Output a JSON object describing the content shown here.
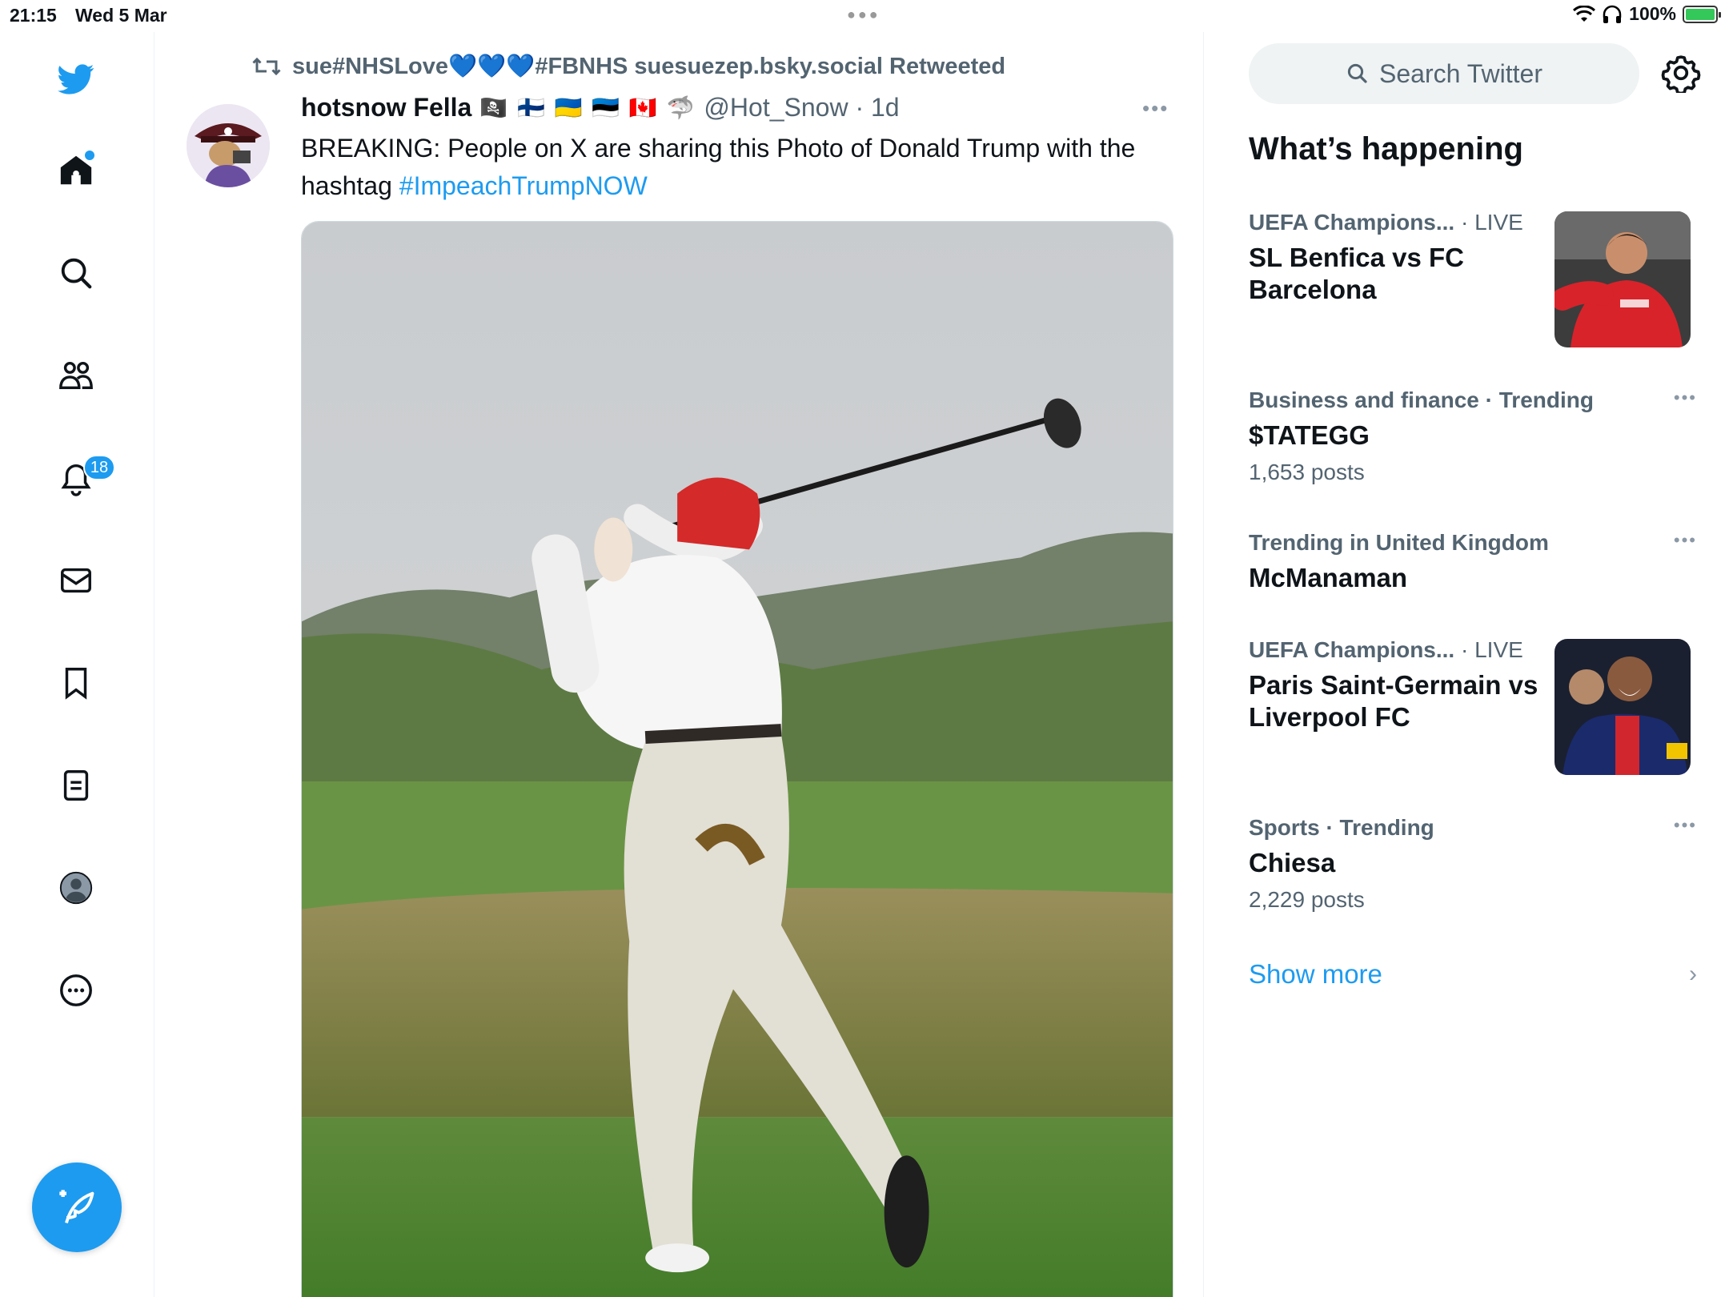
{
  "status_bar": {
    "time": "21:15",
    "date": "Wed 5 Mar",
    "battery": "100%"
  },
  "nav": {
    "notifications_badge": "18"
  },
  "tweet": {
    "retweeted_by": "sue#NHSLove💙💙💙#FBNHS suesuezep.bsky.social Retweeted",
    "author_name": "hotsnow Fella",
    "author_flags": "🏴‍☠️ 🇫🇮 🇺🇦 🇪🇪 🇨🇦 🦈",
    "handle_time": "@Hot_Snow · 1d",
    "text_prefix": "BREAKING: People on X are sharing this Photo of Donald Trump with the hashtag ",
    "hashtag": "#ImpeachTrumpNOW"
  },
  "sidebar": {
    "search_placeholder": "Search Twitter",
    "heading": "What’s happening",
    "trends": [
      {
        "category": "UEFA Champions...",
        "tag": " · LIVE",
        "title": "SL Benfica vs FC Barcelona",
        "count": ""
      },
      {
        "category": "Business and finance · Trending",
        "tag": "",
        "title": "$TATEGG",
        "count": "1,653 posts"
      },
      {
        "category": "Trending in United Kingdom",
        "tag": "",
        "title": "McManaman",
        "count": ""
      },
      {
        "category": "UEFA Champions...",
        "tag": " · LIVE",
        "title": "Paris Saint-Germain vs Liverpool FC",
        "count": ""
      },
      {
        "category": "Sports · Trending",
        "tag": "",
        "title": "Chiesa",
        "count": "2,229 posts"
      }
    ],
    "show_more": "Show more"
  },
  "colors": {
    "accent": "#1d9bf0",
    "text": "#0f1419",
    "muted": "#536471"
  }
}
